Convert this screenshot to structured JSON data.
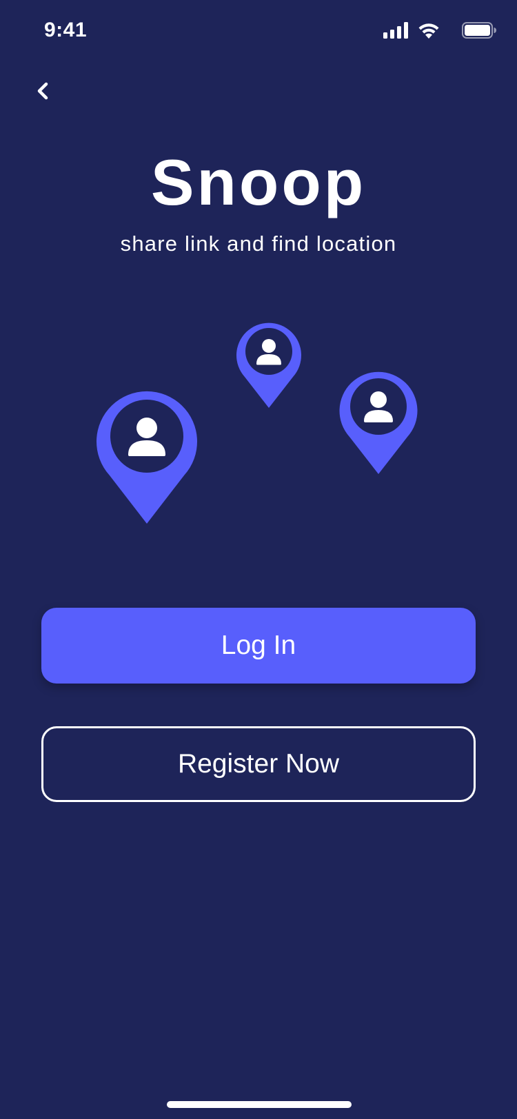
{
  "status_bar": {
    "time": "9:41",
    "icons": [
      "signal-icon",
      "wifi-icon",
      "battery-icon"
    ]
  },
  "header": {
    "back_icon": "chevron-left-icon"
  },
  "hero": {
    "title": "Snoop",
    "subtitle": "share link and find location"
  },
  "illustration": {
    "pin_icon": "location-pin-person-icon",
    "pin_count": 3
  },
  "actions": {
    "login_label": "Log In",
    "register_label": "Register Now"
  },
  "colors": {
    "background": "#1e2459",
    "accent": "#585ffc",
    "text": "#ffffff"
  }
}
